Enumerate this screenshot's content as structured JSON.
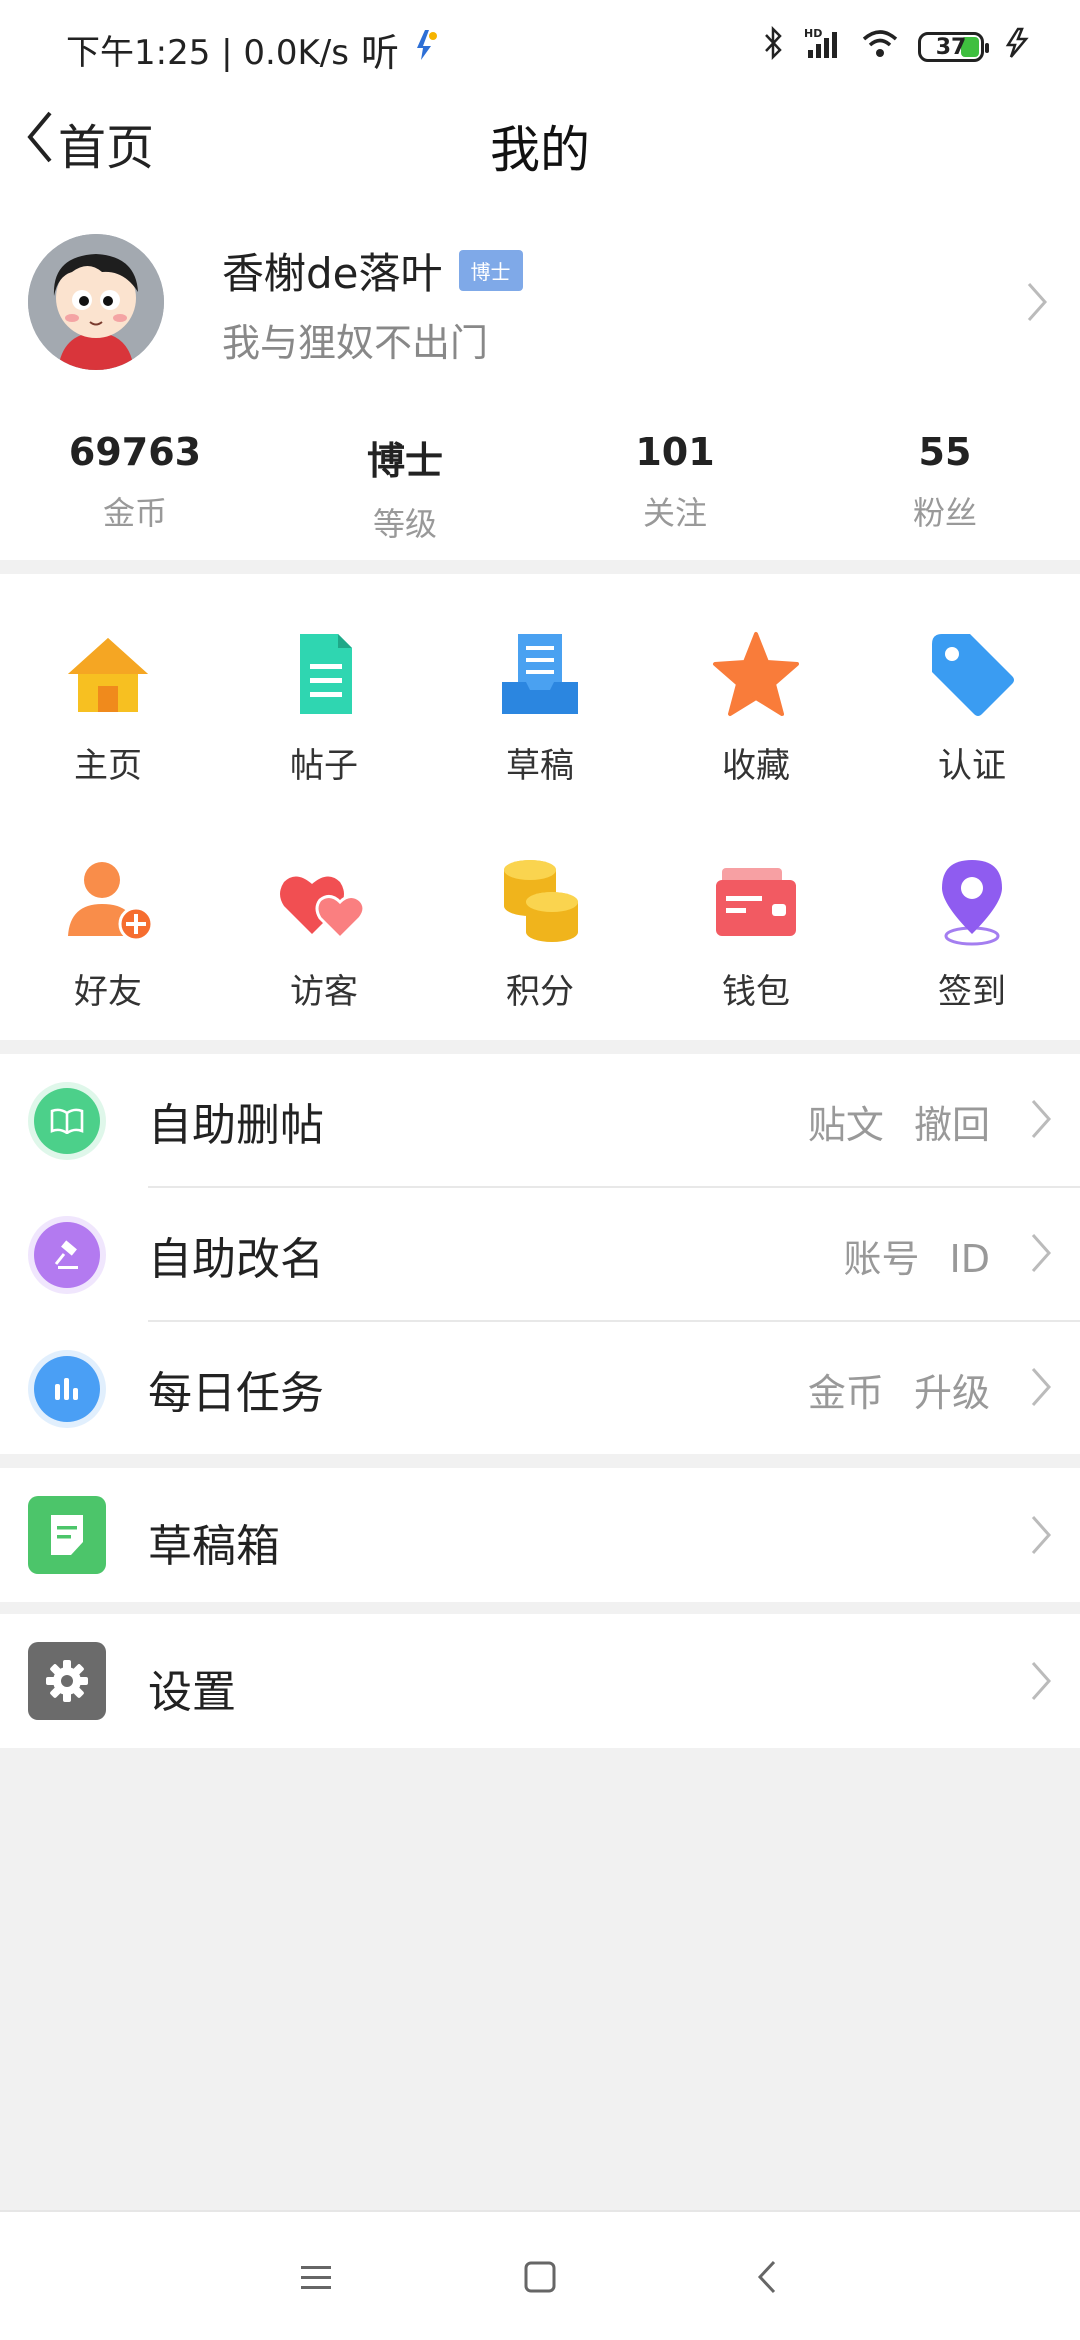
{
  "status_bar": {
    "time_speed": "下午1:25 | 0.0K/s",
    "listen": "听",
    "battery": "37"
  },
  "nav": {
    "back_label": "首页",
    "title": "我的"
  },
  "profile": {
    "username": "香榭de落叶",
    "badge": "博士",
    "signature": "我与狸奴不出门",
    "stats": [
      {
        "value": "69763",
        "label": "金币"
      },
      {
        "value": "博士",
        "label": "等级"
      },
      {
        "value": "101",
        "label": "关注"
      },
      {
        "value": "55",
        "label": "粉丝"
      }
    ]
  },
  "grid": {
    "items": [
      {
        "label": "主页",
        "icon": "home-icon"
      },
      {
        "label": "帖子",
        "icon": "document-icon"
      },
      {
        "label": "草稿",
        "icon": "draft-tray-icon"
      },
      {
        "label": "收藏",
        "icon": "star-icon"
      },
      {
        "label": "认证",
        "icon": "tag-icon"
      },
      {
        "label": "好友",
        "icon": "add-friend-icon"
      },
      {
        "label": "访客",
        "icon": "hearts-icon"
      },
      {
        "label": "积分",
        "icon": "coins-icon"
      },
      {
        "label": "钱包",
        "icon": "wallet-icon"
      },
      {
        "label": "签到",
        "icon": "location-pin-icon"
      }
    ]
  },
  "menu": {
    "self_delete": {
      "label": "自助删帖",
      "right": "贴文 撤回"
    },
    "self_rename": {
      "label": "自助改名",
      "right": "账号 ID"
    },
    "daily_tasks": {
      "label": "每日任务",
      "right": "金币 升级"
    },
    "drafts_box": {
      "label": "草稿箱"
    },
    "settings": {
      "label": "设置"
    }
  },
  "colors": {
    "accent_blue": "#4a9ff5",
    "badge": "#7fa9e8",
    "green": "#4cc56a",
    "gray_bg": "#f1f1f1"
  }
}
